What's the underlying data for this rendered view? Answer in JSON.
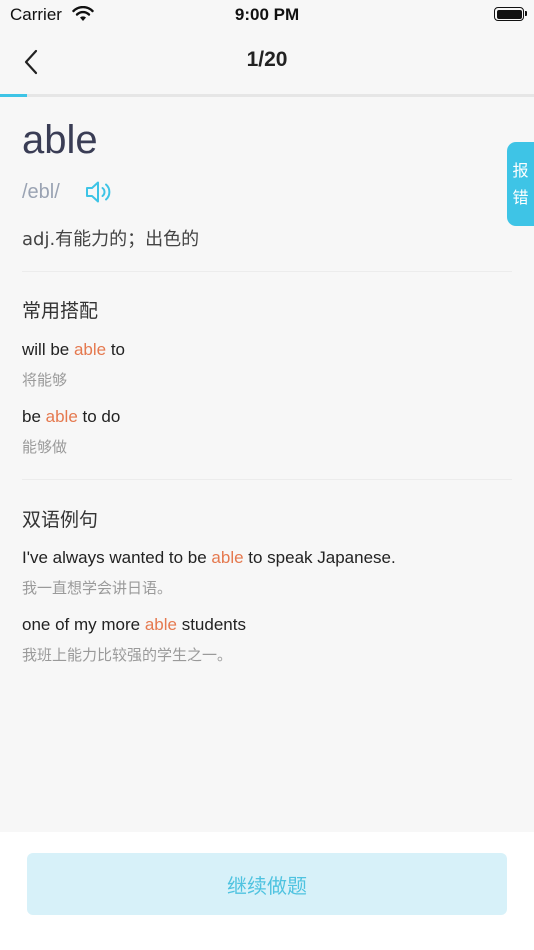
{
  "status_bar": {
    "carrier": "Carrier",
    "time": "9:00 PM"
  },
  "nav": {
    "title": "1/20",
    "progress_fraction": 0.05
  },
  "word": {
    "headword": "able",
    "phonetic": "/ebl/",
    "definition": "adj.有能力的；出色的"
  },
  "report": {
    "chars": [
      "报",
      "错"
    ]
  },
  "collocations": {
    "title": "常用搭配",
    "items": [
      {
        "pre": "will be ",
        "hl": "able",
        "post": " to",
        "cn": "将能够"
      },
      {
        "pre": "be ",
        "hl": "able",
        "post": " to do",
        "cn": "能够做"
      }
    ]
  },
  "examples": {
    "title": "双语例句",
    "items": [
      {
        "pre": "I've always wanted to be ",
        "hl": "able",
        "post": " to speak Japanese.",
        "cn": "我一直想学会讲日语。"
      },
      {
        "pre": "one of my more ",
        "hl": "able",
        "post": " students",
        "cn": "我班上能力比较强的学生之一。"
      }
    ]
  },
  "continue_button": {
    "label": "继续做题"
  },
  "colors": {
    "accent": "#3ec4e6",
    "highlight": "#e5794f",
    "button_bg": "#d7f1f9"
  }
}
